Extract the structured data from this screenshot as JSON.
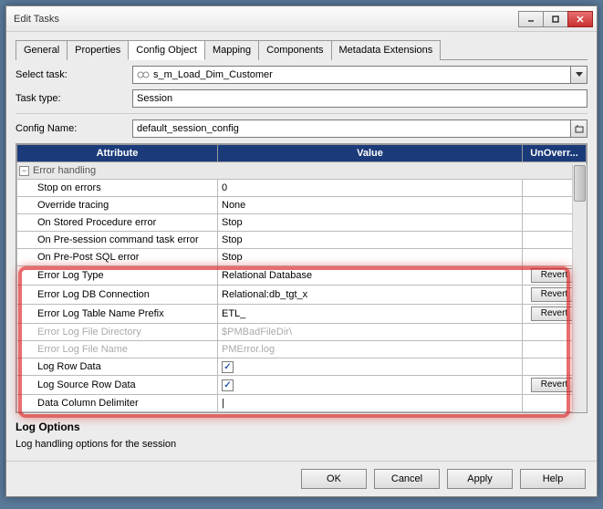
{
  "window": {
    "title": "Edit Tasks"
  },
  "tabs": [
    "General",
    "Properties",
    "Config Object",
    "Mapping",
    "Components",
    "Metadata Extensions"
  ],
  "active_tab": 2,
  "form": {
    "select_task_label": "Select task:",
    "select_task_value": "s_m_Load_Dim_Customer",
    "task_type_label": "Task type:",
    "task_type_value": "Session",
    "config_name_label": "Config Name:",
    "config_name_value": "default_session_config"
  },
  "columns": {
    "attribute": "Attribute",
    "value": "Value",
    "unoverr": "UnOverr..."
  },
  "group_label": "Error handling",
  "rows": [
    {
      "attr": "Stop on errors",
      "val": "0",
      "revert": false,
      "disabled": false,
      "check": null
    },
    {
      "attr": "Override tracing",
      "val": "None",
      "revert": false,
      "disabled": false,
      "check": null
    },
    {
      "attr": "On Stored Procedure error",
      "val": "Stop",
      "revert": false,
      "disabled": false,
      "check": null
    },
    {
      "attr": "On Pre-session command task error",
      "val": "Stop",
      "revert": false,
      "disabled": false,
      "check": null
    },
    {
      "attr": "On Pre-Post SQL error",
      "val": "Stop",
      "revert": false,
      "disabled": false,
      "check": null
    },
    {
      "attr": "Error Log Type",
      "val": "Relational Database",
      "revert": true,
      "disabled": false,
      "check": null
    },
    {
      "attr": "Error Log DB Connection",
      "val": "Relational:db_tgt_x",
      "revert": true,
      "disabled": false,
      "check": null
    },
    {
      "attr": "Error Log Table Name Prefix",
      "val": "ETL_",
      "revert": true,
      "disabled": false,
      "check": null
    },
    {
      "attr": "Error Log File Directory",
      "val": "$PMBadFileDir\\",
      "revert": false,
      "disabled": true,
      "check": null
    },
    {
      "attr": "Error Log File Name",
      "val": "PMError.log",
      "revert": false,
      "disabled": true,
      "check": null
    },
    {
      "attr": "Log Row Data",
      "val": "",
      "revert": false,
      "disabled": false,
      "check": true
    },
    {
      "attr": "Log Source Row Data",
      "val": "",
      "revert": true,
      "disabled": false,
      "check": true
    },
    {
      "attr": "Data Column Delimiter",
      "val": "|",
      "revert": false,
      "disabled": false,
      "check": null
    }
  ],
  "revert_label": "Revert",
  "log_options": {
    "title": "Log Options",
    "desc": "Log handling options for the session"
  },
  "buttons": {
    "ok": "OK",
    "cancel": "Cancel",
    "apply": "Apply",
    "help": "Help"
  }
}
